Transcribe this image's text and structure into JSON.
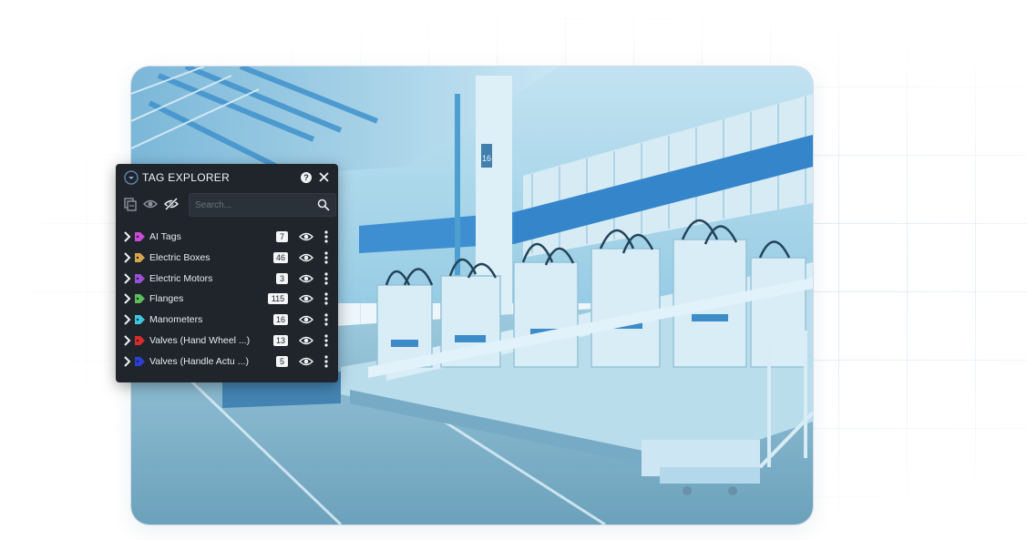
{
  "panel": {
    "title": "TAG EXPLORER",
    "help_label": "?"
  },
  "toolbar": {
    "icons": [
      "copy-icon",
      "eye-icon",
      "eye-off-icon"
    ]
  },
  "search": {
    "placeholder": "Search...",
    "value": ""
  },
  "tags": [
    {
      "label": "AI Tags",
      "count": "7",
      "color": "#c94ad6"
    },
    {
      "label": "Electric Boxes",
      "count": "46",
      "color": "#d7a54a"
    },
    {
      "label": "Electric Motors",
      "count": "3",
      "color": "#9a4fd8"
    },
    {
      "label": "Flanges",
      "count": "115",
      "color": "#5cbf5a"
    },
    {
      "label": "Manometers",
      "count": "16",
      "color": "#3ec6e0"
    },
    {
      "label": "Valves (Hand Wheel ...)",
      "count": "13",
      "color": "#d92b2b"
    },
    {
      "label": "Valves (Handle Actu ...)",
      "count": "5",
      "color": "#2b3fd6"
    }
  ],
  "photo": {
    "pillar_label": "16",
    "subject": "factory-production-line"
  }
}
